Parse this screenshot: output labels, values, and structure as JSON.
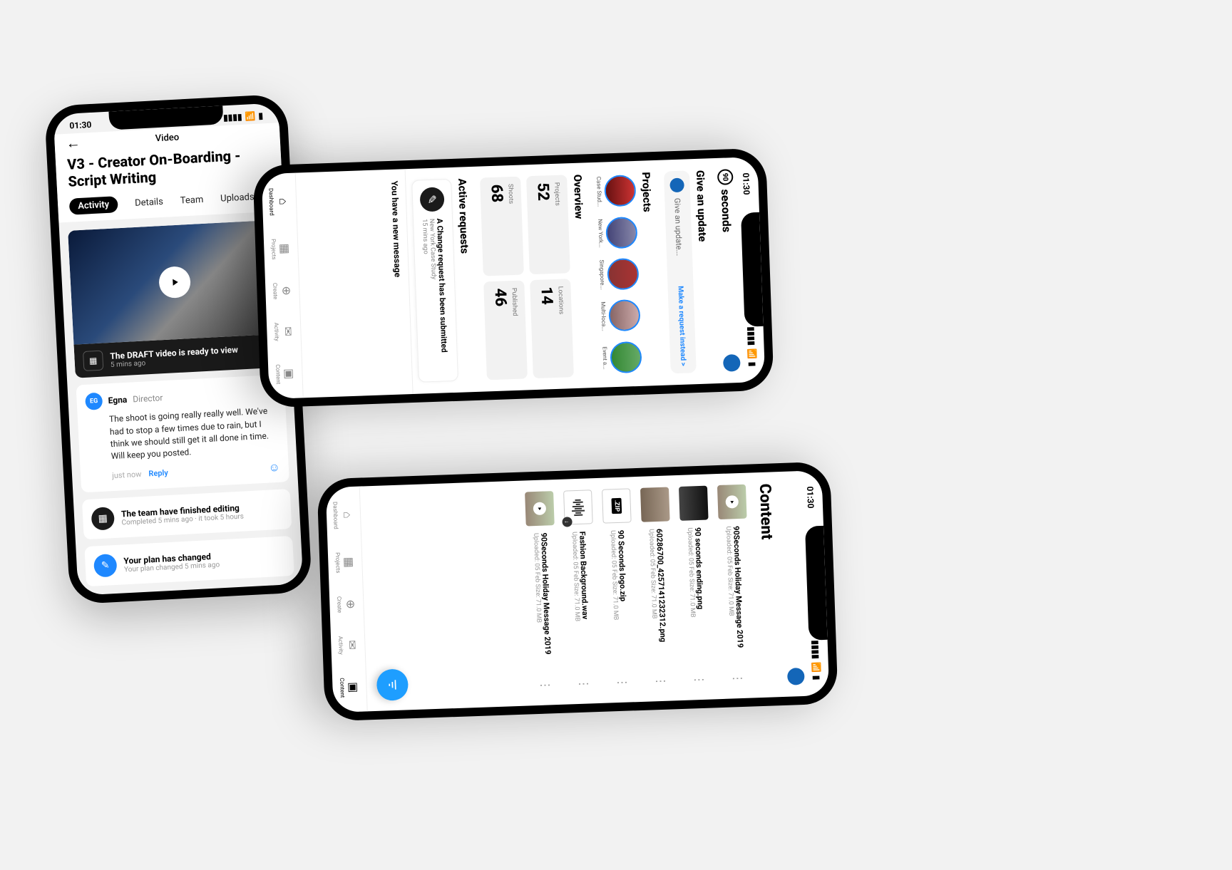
{
  "status_time": "01:30",
  "phone1": {
    "topbar": "Video",
    "title": "V3 - Creator On-Boarding - Script Writing",
    "tabs": {
      "activity": "Activity",
      "details": "Details",
      "team": "Team",
      "uploads": "Uploads"
    },
    "video": {
      "title": "The DRAFT video is ready to view",
      "time": "5 mins ago"
    },
    "comment": {
      "initials": "EG",
      "name": "Egna",
      "role": "Director",
      "body": "The shoot is going really really well. We've had to stop a few times due to rain, but I think we should still get it all done in time. Will keep you posted.",
      "time": "just now",
      "reply": "Reply"
    },
    "editing": {
      "title": "The team have finished editing",
      "sub": "Completed 5 mins ago · it took 5 hours"
    },
    "plan": {
      "title": "Your plan has changed",
      "sub": "Your plan changed 5 mins ago"
    }
  },
  "phone2": {
    "brand": "seconds",
    "update": {
      "title": "Give an update",
      "placeholder": "Give an update...",
      "link": "Make a request instead >"
    },
    "projects_title": "Projects",
    "projects": [
      "Case Stud...",
      "New York...",
      "Singapore...",
      "Multi-loca...",
      "Event a..."
    ],
    "overview_title": "Overview",
    "stats": [
      {
        "label": "Projects",
        "value": "52"
      },
      {
        "label": "Locations",
        "value": "14"
      },
      {
        "label": "Shoots",
        "value": "68"
      },
      {
        "label": "Published",
        "value": "46"
      }
    ],
    "active_title": "Active requests",
    "request": {
      "title": "A Change request has been submitted",
      "sub": "New York Case Study",
      "time": "15 mins ago"
    },
    "message": "You have a new message",
    "nav": {
      "dashboard": "Dashboard",
      "projects": "Projects",
      "create": "Create",
      "activity": "Activity",
      "content": "Content"
    }
  },
  "phone3": {
    "title": "Content",
    "files": [
      {
        "name": "90Seconds Holiday Message 2019",
        "meta": "Uploaded: 05 Feb  Size: 71.0 MB",
        "type": "vid"
      },
      {
        "name": "90 seconds ending.png",
        "meta": "Uploaded: 05 Feb  Size: 71.0 MB",
        "type": "img1"
      },
      {
        "name": "60286700_4257141232312.png",
        "meta": "Uploaded: 05 Feb  Size: 71.0 MB",
        "type": "img2"
      },
      {
        "name": "90 Seconds logo.zip",
        "meta": "Uploaded: 05 Feb  Size: 71.0 MB",
        "type": "zip"
      },
      {
        "name": "Fashion Background.wav",
        "meta": "Uploaded: 05 Feb  Size: 71.0 MB",
        "type": "aud"
      },
      {
        "name": "90Seconds Holiday Message 2019",
        "meta": "Uploaded: 05 Feb  Size: 71.0 MB",
        "type": "vid"
      }
    ],
    "nav": {
      "dashboard": "Dashboard",
      "projects": "Projects",
      "create": "Create",
      "activity": "Activity",
      "content": "Content"
    }
  }
}
